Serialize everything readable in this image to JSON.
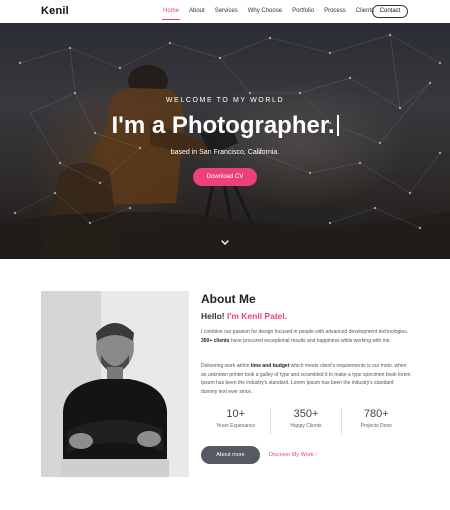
{
  "nav": {
    "brand": "Kenil",
    "links": [
      {
        "label": "Home",
        "active": true
      },
      {
        "label": "About",
        "active": false
      },
      {
        "label": "Services",
        "active": false
      },
      {
        "label": "Why Choose",
        "active": false
      },
      {
        "label": "Portfolio",
        "active": false
      },
      {
        "label": "Process",
        "active": false
      },
      {
        "label": "Clients",
        "active": false
      }
    ],
    "contact_label": "Contact"
  },
  "hero": {
    "welcome": "WELCOME TO MY WORLD",
    "title": "I'm a Photographer.",
    "subtitle": "based in San Francisco, California.",
    "cv_button": "Download CV",
    "scroll_icon": "chevron-down-icon"
  },
  "about": {
    "title": "About Me",
    "hello_prefix": "Hello! ",
    "hello_name": "I'm Kenil Patel.",
    "p1": {
      "t1": "I combine our passion for design focused in people with advanced development technologies. ",
      "b1": "350+ clients",
      "t2": " have procured exceptional results and happiness while working with me."
    },
    "p2": {
      "t1": "Delivering work within ",
      "b1": "time and budget",
      "t2": " which meets client's requirements is our moto. when an unknown printer took a galley of type and scrambled it to make a type specimen book lorem Ipsum has been the industry's standard. Lorem Ipsum has been the industry's standard dummy text ever since."
    },
    "stats": [
      {
        "number": "10+",
        "label": "Years Experiance"
      },
      {
        "number": "350+",
        "label": "Happy Clients"
      },
      {
        "number": "780+",
        "label": "Projects Done"
      }
    ],
    "more_button": "About more",
    "discover_link": "Discover My Work ›"
  },
  "colors": {
    "accent": "#ec407a",
    "dark_button": "#555a60"
  }
}
